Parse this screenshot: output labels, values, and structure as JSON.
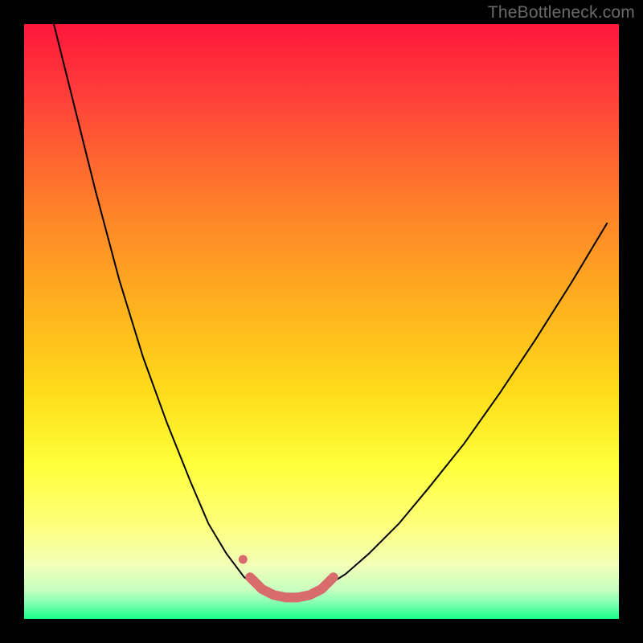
{
  "watermark": "TheBottleneck.com",
  "chart_data": {
    "type": "line",
    "title": "",
    "xlabel": "",
    "ylabel": "",
    "xlim": [
      0,
      100
    ],
    "ylim": [
      0,
      100
    ],
    "grid": false,
    "legend": false,
    "background_gradient": {
      "top_color": "#ff1a3a",
      "mid_colors": [
        "#ff7a2a",
        "#ffd21e",
        "#ffff55",
        "#f6ffb2"
      ],
      "bottom_color": "#19ff8a"
    },
    "series": [
      {
        "name": "curve-left",
        "color": "#000000",
        "stroke_width": 2,
        "x": [
          5.0,
          8.0,
          12.0,
          16.0,
          20.0,
          24.0,
          28.0,
          31.0,
          34.0,
          37.0,
          40.0
        ],
        "y_value": [
          100.0,
          88.0,
          72.0,
          57.0,
          44.0,
          33.0,
          23.0,
          16.0,
          11.0,
          7.0,
          5.0
        ]
      },
      {
        "name": "curve-right",
        "color": "#000000",
        "stroke_width": 2,
        "x": [
          50.0,
          54.0,
          58.0,
          63.0,
          68.0,
          74.0,
          80.0,
          86.0,
          92.0,
          98.0
        ],
        "y_value": [
          5.0,
          7.5,
          11.0,
          16.0,
          22.0,
          29.5,
          38.0,
          47.0,
          56.5,
          66.5
        ]
      },
      {
        "name": "optimal-band",
        "type": "marker-segment",
        "color": "#d86b6b",
        "stroke_width": 12,
        "x": [
          38.0,
          40.0,
          42.0,
          44.0,
          46.0,
          48.0,
          50.0,
          52.0
        ],
        "y_value": [
          7.0,
          5.0,
          4.0,
          3.6,
          3.6,
          4.0,
          5.0,
          7.0
        ]
      }
    ],
    "annotations": []
  }
}
